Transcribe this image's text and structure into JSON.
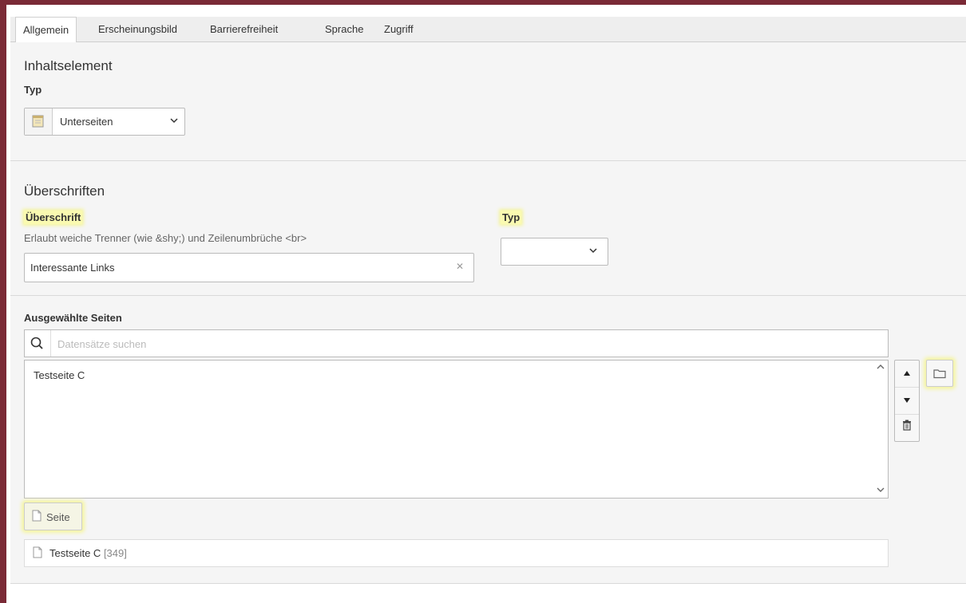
{
  "tabs": [
    "Allgemein",
    "Erscheinungsbild",
    "Barrierefreiheit",
    "Sprache",
    "Zugriff"
  ],
  "section_content": {
    "title": "Inhaltselement",
    "type_label": "Typ",
    "type_value": "Unterseiten"
  },
  "section_headers": {
    "title": "Überschriften",
    "header_label": "Überschrift",
    "header_hint": "Erlaubt weiche Trenner (wie &shy;) und Zeilenumbrüche <br>",
    "header_value": "Interessante Links",
    "type_label": "Typ",
    "type_value": ""
  },
  "section_pages": {
    "title": "Ausgewählte Seiten",
    "search_placeholder": "Datensätze suchen",
    "selected_items": [
      "Testseite C"
    ],
    "add_page_label": "Seite",
    "result_title": "Testseite C",
    "result_id": "[349]"
  },
  "icons": {
    "type": "content-page-icon",
    "search": "search-icon",
    "up": "move-up-icon",
    "down": "move-down-icon",
    "delete": "trash-icon",
    "folder": "folder-icon",
    "page": "page-icon"
  },
  "colors": {
    "frame": "#7a2a36",
    "highlight": "#fafab0",
    "section_bg": "#f5f5f5"
  }
}
